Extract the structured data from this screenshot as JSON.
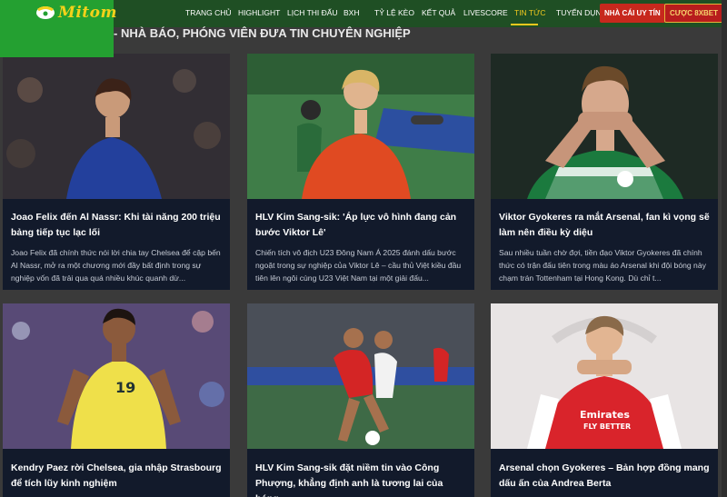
{
  "logo": {
    "text": "Mitom"
  },
  "nav": {
    "items": [
      {
        "label": "TRANG CHỦ"
      },
      {
        "label": "HIGHLIGHT"
      },
      {
        "label": "LỊCH THI ĐẤU"
      },
      {
        "label": "BXH"
      },
      {
        "label": "TỶ LỆ KÈO"
      },
      {
        "label": "KẾT QUẢ"
      },
      {
        "label": "LIVESCORE"
      },
      {
        "label": "TIN TỨC"
      },
      {
        "label": "TUYỂN DỤNG"
      }
    ],
    "active": "TIN TỨC",
    "cta_primary": "NHÀ CÁI UY TÍN",
    "cta_secondary": "CƯỢC 8XBET"
  },
  "section_title": "- NHÀ BÁO, PHÓNG VIÊN ĐƯA TIN CHUYÊN NGHIỆP",
  "articles": [
    {
      "title": "Joao Felix đến Al Nassr: Khi tài năng 200 triệu bảng tiếp tục lạc lối",
      "excerpt": "Joao Felix đã chính thức nói lời chia tay Chelsea để cập bến Al Nassr, mở ra một chương mới đầy bất định trong sự nghiệp vốn đã trải qua quá nhiều khúc quanh dừ...",
      "colors": {
        "bg": "#2b2d38",
        "shirt": "#23409c"
      }
    },
    {
      "title": "HLV Kim Sang-sik: 'Áp lực vô hình đang cản bước Viktor Lê'",
      "excerpt": "Chiến tích vô địch U23 Đông Nam Á 2025 đánh dấu bước ngoặt trong sự nghiệp của Viktor Lê – cầu thủ Việt kiều đầu tiên lên ngôi cùng U23 Việt Nam tại một giải đấu...",
      "colors": {
        "bg": "#3f7d48",
        "shirt": "#e04a22"
      }
    },
    {
      "title": "Viktor Gyokeres ra mắt Arsenal, fan kì vọng sẽ làm nên điều kỳ diệu",
      "excerpt": "Sau nhiều tuần chờ đợi, tiền đạo Viktor Gyokeres đã chính thức có trận đấu tiên trong màu áo Arsenal khi đội bóng này chạm trán Tottenham tại Hong Kong. Dù chỉ t...",
      "colors": {
        "bg": "#1e2a24",
        "shirt": "#1b7a3e"
      }
    },
    {
      "title": "Kendry Paez rời Chelsea, gia nhập Strasbourg để tích lũy kinh nghiệm",
      "excerpt": "",
      "colors": {
        "bg": "#3a4f8a",
        "shirt": "#efe04a"
      }
    },
    {
      "title": "HLV Kim Sang-sik đặt niềm tin vào Công Phượng, khẳng định anh là tương lai của bóng...",
      "excerpt": "",
      "colors": {
        "bg": "#3e6a46",
        "shirt": "#d42525"
      }
    },
    {
      "title": "Arsenal chọn Gyokeres – Bản hợp đồng mang dấu ấn của Andrea Berta",
      "excerpt": "",
      "colors": {
        "bg": "#e8e4e4",
        "shirt": "#d9242b"
      }
    }
  ]
}
